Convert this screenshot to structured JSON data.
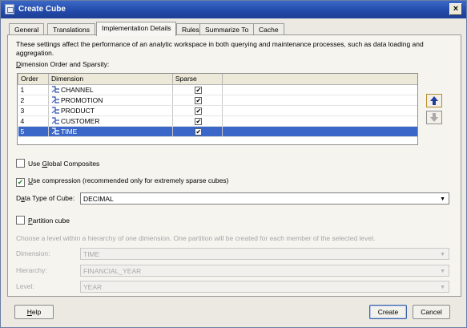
{
  "window": {
    "title": "Create Cube"
  },
  "tabs": [
    {
      "label": "General"
    },
    {
      "label": "Translations"
    },
    {
      "label": "Implementation Details"
    },
    {
      "label": "Rules"
    },
    {
      "label": "Summarize To"
    },
    {
      "label": "Cache"
    }
  ],
  "active_tab": "Implementation Details",
  "description": "These settings affect the performance of an analytic workspace in both querying and maintenance processes, such as data loading and aggregation.",
  "dimension_section": {
    "label_prefix": "D",
    "label_rest": "imension Order and Sparsity:"
  },
  "grid": {
    "headers": {
      "order": "Order",
      "dimension": "Dimension",
      "sparse": "Sparse"
    },
    "rows": [
      {
        "order": "1",
        "dimension": "CHANNEL",
        "sparse": true
      },
      {
        "order": "2",
        "dimension": "PROMOTION",
        "sparse": true
      },
      {
        "order": "3",
        "dimension": "PRODUCT",
        "sparse": true
      },
      {
        "order": "4",
        "dimension": "CUSTOMER",
        "sparse": true
      },
      {
        "order": "5",
        "dimension": "TIME",
        "sparse": true,
        "selected": true
      }
    ]
  },
  "options": {
    "global_composites": {
      "pre": "Use ",
      "mn": "G",
      "post": "lobal Composites",
      "checked": false
    },
    "compression": {
      "pre": "",
      "mn": "U",
      "post": "se compression (recommended only for extremely sparse cubes)",
      "checked": true
    },
    "data_type": {
      "pre": "D",
      "mn": "a",
      "post": "ta Type of Cube:",
      "value": "DECIMAL"
    },
    "partition": {
      "pre": "",
      "mn": "P",
      "post": "artition cube",
      "checked": false
    }
  },
  "partition_hint": "Choose a level within a hierarchy of one dimension. One partition will be created for each member of the selected level.",
  "partition_fields": {
    "dimension": {
      "label": "Dimension:",
      "value": "TIME"
    },
    "hierarchy": {
      "label": "Hierarchy:",
      "value": "FINANCIAL_YEAR"
    },
    "level": {
      "label": "Level:",
      "value": "YEAR"
    }
  },
  "buttons": {
    "help": {
      "mn": "H",
      "rest": "elp"
    },
    "create": "Create",
    "cancel": "Cancel"
  },
  "colors": {
    "title_bar": "#2149a8",
    "selection": "#3a67c8",
    "dialog_bg": "#ebe9e2"
  },
  "icons": {
    "title": "cube-icon",
    "close": "close-icon",
    "dimension": "dimension-icon",
    "move_up": "arrow-up-icon",
    "move_down": "arrow-down-icon",
    "dropdown": "chevron-down-icon"
  }
}
